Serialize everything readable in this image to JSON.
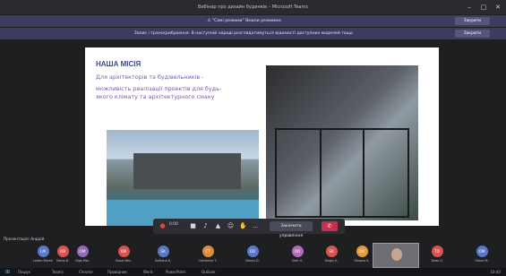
{
  "window": {
    "title": "Вебінар про дизайн будинків – Microsoft Teams",
    "min": "–",
    "max": "□",
    "close": "✕"
  },
  "banners": [
    {
      "text": "⚠ \"Самі режими\" Вмили режимом",
      "button": "Закрити"
    },
    {
      "text": "Запис і транскрибування. В наступній нараді розглядатимуться відомості доступних моделей тощо.",
      "button": "Закрити"
    }
  ],
  "slide": {
    "heading": "НАША МІСІЯ",
    "line1": "Для архітекторів та будівельників -",
    "line2": "можливість реалізації проектів для будь-якого клімату та архітектурного смаку"
  },
  "controls": {
    "time": "0:00",
    "share_label": "Закінчити управління",
    "hangup_icon": "✆"
  },
  "presenter_label": "Презентація: Андрій",
  "participants": [
    {
      "initials": "LM",
      "name": "Lorem Meren",
      "color": "#5a78c8"
    },
    {
      "initials": "OB",
      "name": "Olena B.",
      "color": "#d9534f"
    },
    {
      "initials": "OM",
      "name": "Olga Mar.",
      "color": "#8e6ab8"
    },
    {
      "initials": "KM",
      "name": "Koval Mar.",
      "color": "#d9534f"
    },
    {
      "initials": "SK",
      "name": "Svitlana K.",
      "color": "#5a78c8"
    },
    {
      "initials": "CT",
      "name": "Catherine T.",
      "color": "#d98c3f"
    },
    {
      "initials": "DD",
      "name": "Denys D.",
      "color": "#5a78c8"
    },
    {
      "initials": "OO",
      "name": "Oleh O.",
      "color": "#b36bb8"
    },
    {
      "initials": "SK",
      "name": "Sergiy K.",
      "color": "#d9534f"
    },
    {
      "initials": "OK",
      "name": "Oksana K.",
      "color": "#e39a3c"
    },
    {
      "initials": "TO",
      "name": "Taras O.",
      "color": "#d9534f"
    },
    {
      "initials": "OM",
      "name": "Olena M.",
      "color": "#5a78c8"
    }
  ],
  "taskbar": {
    "apps": [
      "Пошук",
      "Teams",
      "Chrome",
      "Провідник",
      "Word",
      "PowerPoint",
      "Outlook"
    ],
    "clock": "10:40"
  }
}
